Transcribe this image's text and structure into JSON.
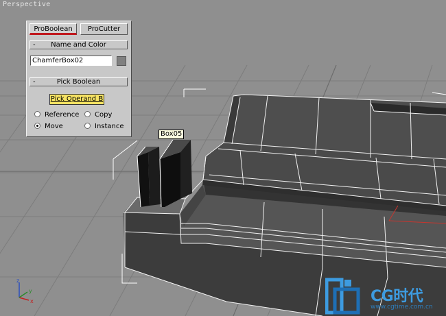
{
  "viewport": {
    "label": "Perspective"
  },
  "panel": {
    "tabs": [
      "ProBoolean",
      "ProCutter"
    ],
    "active_tab": "ProBoolean",
    "name_rollout": {
      "collapse": "-",
      "title": "Name and Color",
      "object_name": "ChamferBox02",
      "swatch_color": "#808080"
    },
    "pick_rollout": {
      "collapse": "-",
      "title": "Pick Boolean",
      "pick_button": "Pick Operand B",
      "options": [
        {
          "label": "Reference",
          "selected": false
        },
        {
          "label": "Copy",
          "selected": false
        },
        {
          "label": "Move",
          "selected": true
        },
        {
          "label": "Instance",
          "selected": false
        }
      ]
    }
  },
  "tooltip": {
    "text": "Box05"
  },
  "axes": {
    "x": "x",
    "y": "y",
    "z": "z"
  },
  "watermark": {
    "brand": "CG时代",
    "url": "www.cgtime.com.cn"
  },
  "colors": {
    "accent_tab": "#c0191e",
    "pick_button": "#f7e463",
    "viewport_bg": "#8f8f8f"
  }
}
